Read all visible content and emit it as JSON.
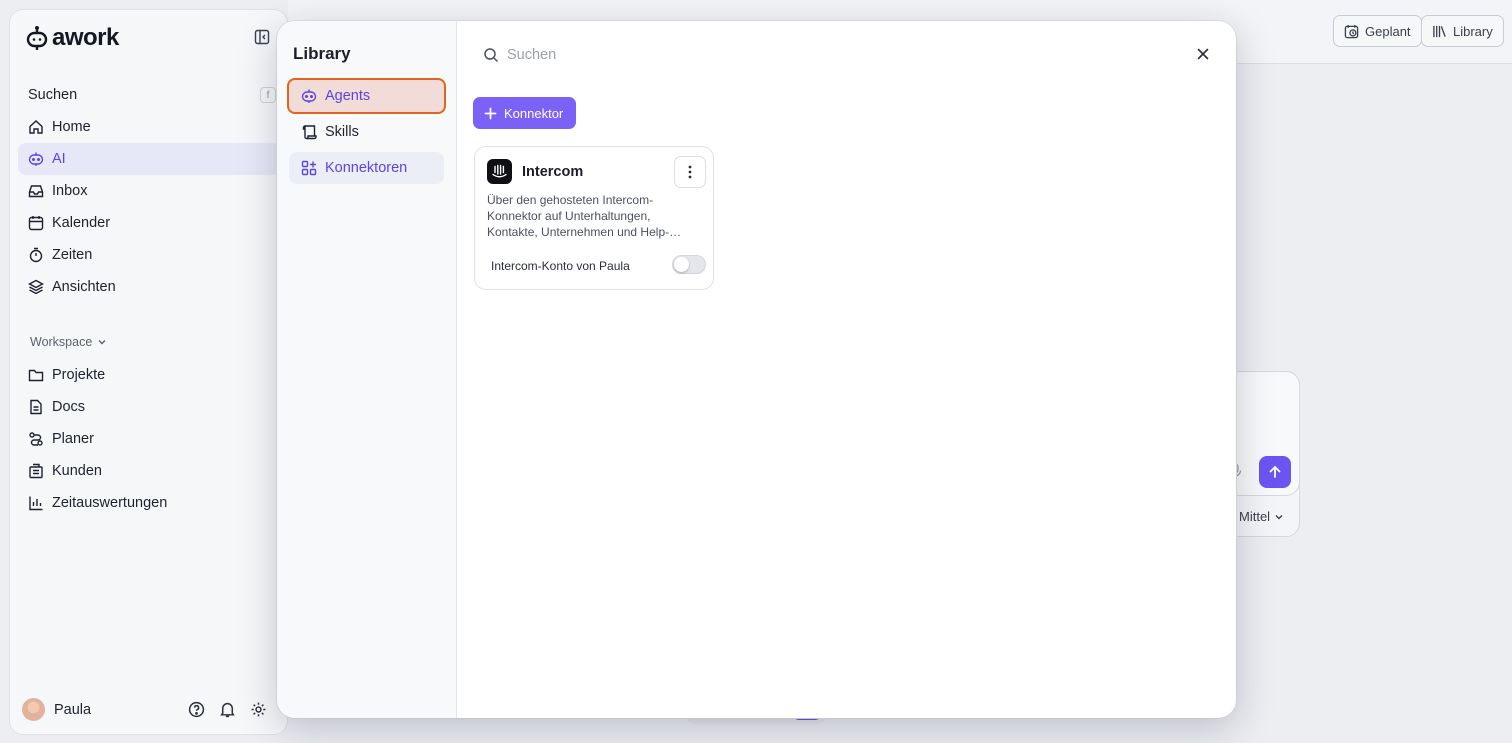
{
  "app": {
    "name": "awork"
  },
  "colors": {
    "accent": "#6a55f0",
    "accent_button": "#7b61f6",
    "focus_outline": "#e0661f"
  },
  "sidebar": {
    "search": {
      "label": "Suchen",
      "shortcut": "f"
    },
    "items": [
      {
        "label": "Home",
        "icon": "home-icon"
      },
      {
        "label": "AI",
        "icon": "ai-bot-icon",
        "active": true
      },
      {
        "label": "Inbox",
        "icon": "inbox-icon"
      },
      {
        "label": "Kalender",
        "icon": "calendar-icon"
      },
      {
        "label": "Zeiten",
        "icon": "stopwatch-icon"
      },
      {
        "label": "Ansichten",
        "icon": "layers-icon"
      }
    ],
    "workspace": {
      "label": "Workspace",
      "items": [
        {
          "label": "Projekte",
          "icon": "folder-icon"
        },
        {
          "label": "Docs",
          "icon": "document-icon"
        },
        {
          "label": "Planer",
          "icon": "planner-icon"
        },
        {
          "label": "Kunden",
          "icon": "building-icon"
        },
        {
          "label": "Zeitauswertungen",
          "icon": "bar-chart-icon"
        }
      ]
    },
    "user": {
      "name": "Paula"
    }
  },
  "topbar": {
    "geplant_label": "Geplant",
    "library_label": "Library"
  },
  "background": {
    "effort_label": "Mittel"
  },
  "library": {
    "title": "Library",
    "nav": [
      {
        "label": "Agents",
        "icon": "ai-bot-icon"
      },
      {
        "label": "Skills",
        "icon": "scroll-icon"
      },
      {
        "label": "Konnektoren",
        "icon": "connectors-icon"
      }
    ],
    "search_placeholder": "Suchen",
    "add_label": "Konnektor",
    "connector": {
      "name": "Intercom",
      "description": "Über den gehosteten Intercom-Konnektor auf Unterhaltungen, Kontakte, Unternehmen und Help-Center-Artikel zugreifen.",
      "account_label": "Intercom-Konto von Paula",
      "enabled": false
    }
  }
}
